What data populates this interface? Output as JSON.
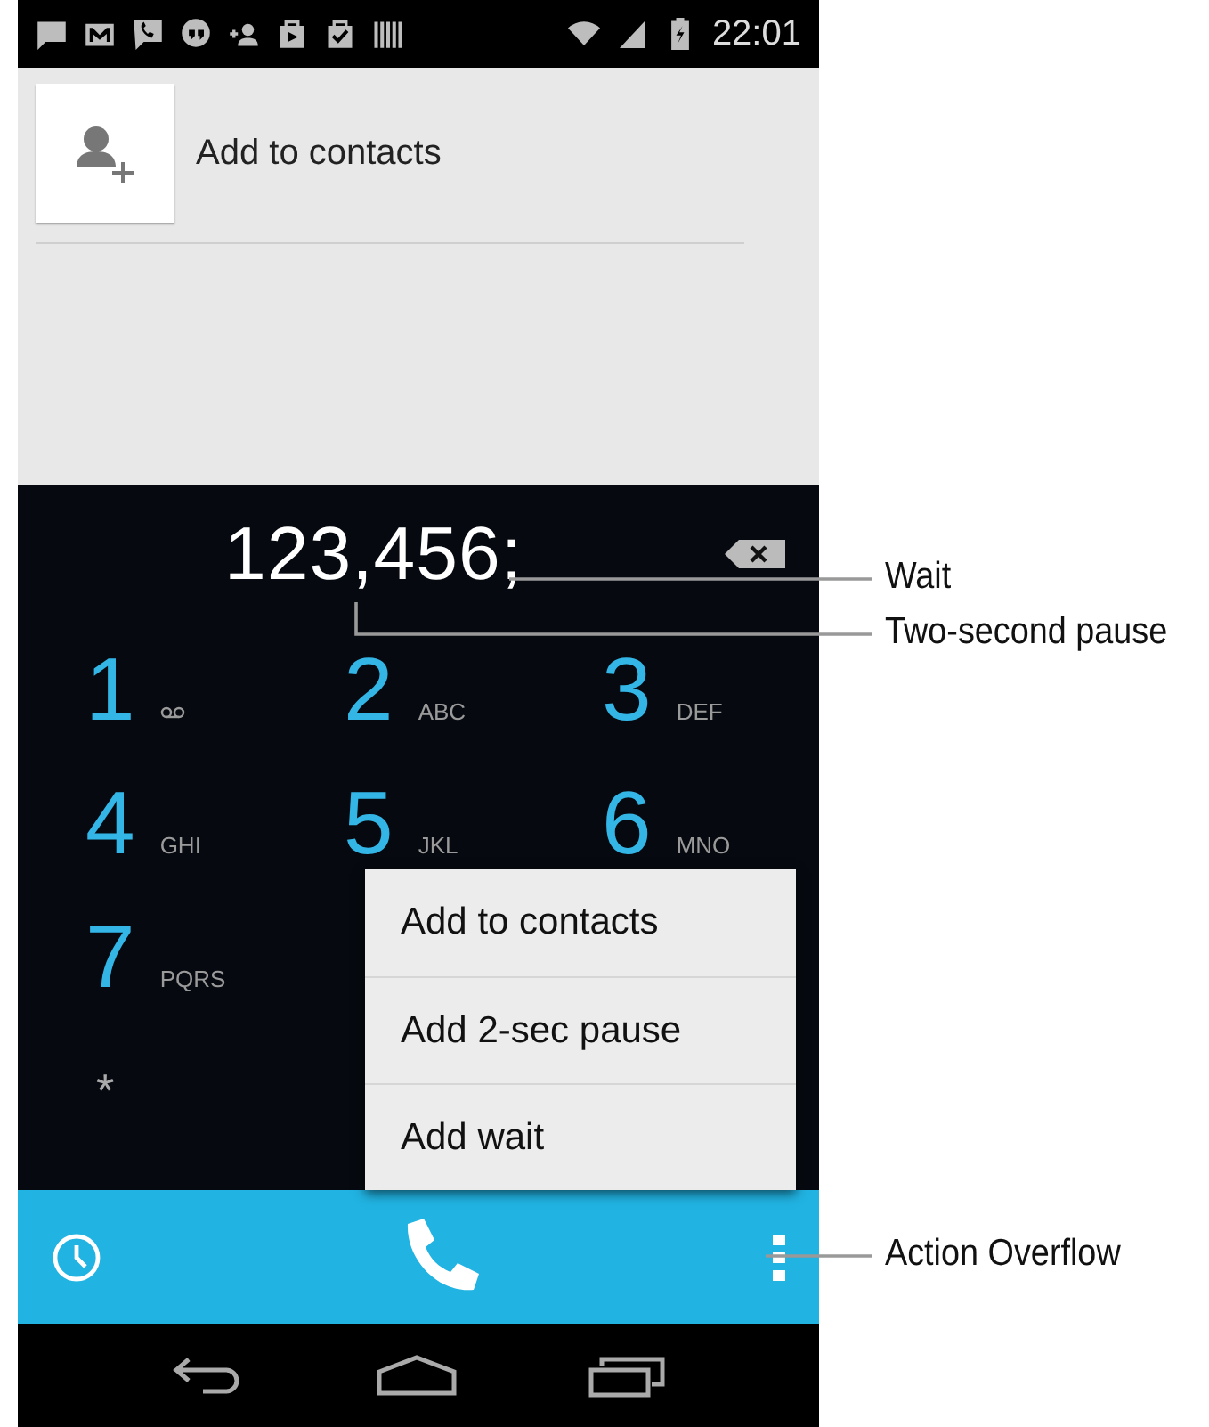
{
  "status_bar": {
    "time": "22:01"
  },
  "suggestion": {
    "label": "Add to contacts"
  },
  "dialer": {
    "number": "123,456;"
  },
  "keypad": [
    {
      "kind": "digit",
      "digit": "1",
      "voicemail": true
    },
    {
      "kind": "digit",
      "digit": "2",
      "letters": "ABC"
    },
    {
      "kind": "digit",
      "digit": "3",
      "letters": "DEF"
    },
    {
      "kind": "digit",
      "digit": "4",
      "letters": "GHI"
    },
    {
      "kind": "digit",
      "digit": "5",
      "letters": "JKL"
    },
    {
      "kind": "digit",
      "digit": "6",
      "letters": "MNO"
    },
    {
      "kind": "digit",
      "digit": "7",
      "letters": "PQRS"
    },
    {
      "kind": "blank"
    },
    {
      "kind": "blank"
    },
    {
      "kind": "symbol",
      "digit": "*"
    }
  ],
  "overflow_menu": [
    {
      "label": "Add to contacts"
    },
    {
      "label": "Add 2-sec pause"
    },
    {
      "label": "Add wait"
    }
  ],
  "callouts": [
    {
      "label": "Wait"
    },
    {
      "label": "Two-second pause"
    },
    {
      "label": "Action Overflow"
    }
  ]
}
